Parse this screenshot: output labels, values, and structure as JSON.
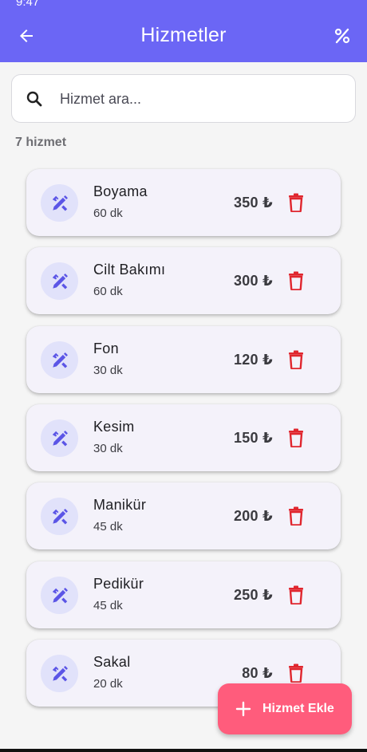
{
  "status_bar": {
    "time": "9:47",
    "system": ""
  },
  "app_bar": {
    "title": "Hizmetler",
    "back_icon": "arrow-back-icon",
    "percent_icon": "percent-icon"
  },
  "search": {
    "placeholder": "Hizmet ara...",
    "value": ""
  },
  "count_label": "7 hizmet",
  "services": [
    {
      "name": "Boyama",
      "duration": "60 dk",
      "price": "350 ₺"
    },
    {
      "name": "Cilt Bakımı",
      "duration": "60 dk",
      "price": "300 ₺"
    },
    {
      "name": "Fon",
      "duration": "30 dk",
      "price": "120 ₺"
    },
    {
      "name": "Kesim",
      "duration": "30 dk",
      "price": "150 ₺"
    },
    {
      "name": "Manikür",
      "duration": "45 dk",
      "price": "200 ₺"
    },
    {
      "name": "Pedikür",
      "duration": "45 dk",
      "price": "250 ₺"
    },
    {
      "name": "Sakal",
      "duration": "20 dk",
      "price": "80 ₺"
    }
  ],
  "fab": {
    "label": "Hizmet Ekle"
  },
  "colors": {
    "primary": "#6b66f5",
    "icon_accent": "#5b55e6",
    "delete": "#e0262e",
    "fab": "#ff5c7c",
    "card": "#f4f2fa"
  }
}
